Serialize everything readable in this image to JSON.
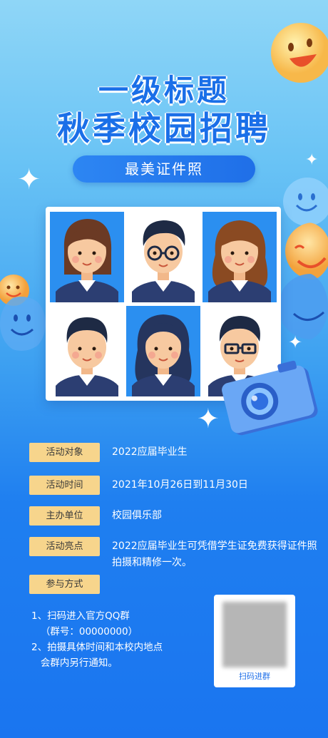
{
  "header": {
    "title_line1": "一级标题",
    "title_line2": "秋季校园招聘",
    "subtitle": "最美证件照"
  },
  "info": [
    {
      "label": "活动对象",
      "value": "2022应届毕业生"
    },
    {
      "label": "活动时间",
      "value": "2021年10月26日到11月30日"
    },
    {
      "label": "主办单位",
      "value": "校园俱乐部"
    },
    {
      "label": "活动亮点",
      "value": "2022应届毕业生可凭借学生证免费获得证件照拍摄和精修一次。"
    },
    {
      "label": "参与方式"
    }
  ],
  "steps": {
    "text": "1、扫码进入官方QQ群\n   （群号：00000000）\n2、拍摄具体时间和本校内地点\n   会群内另行通知。"
  },
  "qr": {
    "caption": "扫码进群"
  },
  "colors": {
    "title_blue": "#1a6fe8",
    "label_gold": "#f7d58c",
    "photo_blue": "#2b8ff0"
  },
  "portraits": [
    {
      "icon": "portrait-girl-short-hair-icon"
    },
    {
      "icon": "portrait-boy-glasses-icon"
    },
    {
      "icon": "portrait-girl-long-hair-icon"
    },
    {
      "icon": "portrait-boy-short-hair-icon"
    },
    {
      "icon": "portrait-girl-dark-long-hair-icon"
    },
    {
      "icon": "portrait-boy-glasses-2-icon"
    }
  ]
}
